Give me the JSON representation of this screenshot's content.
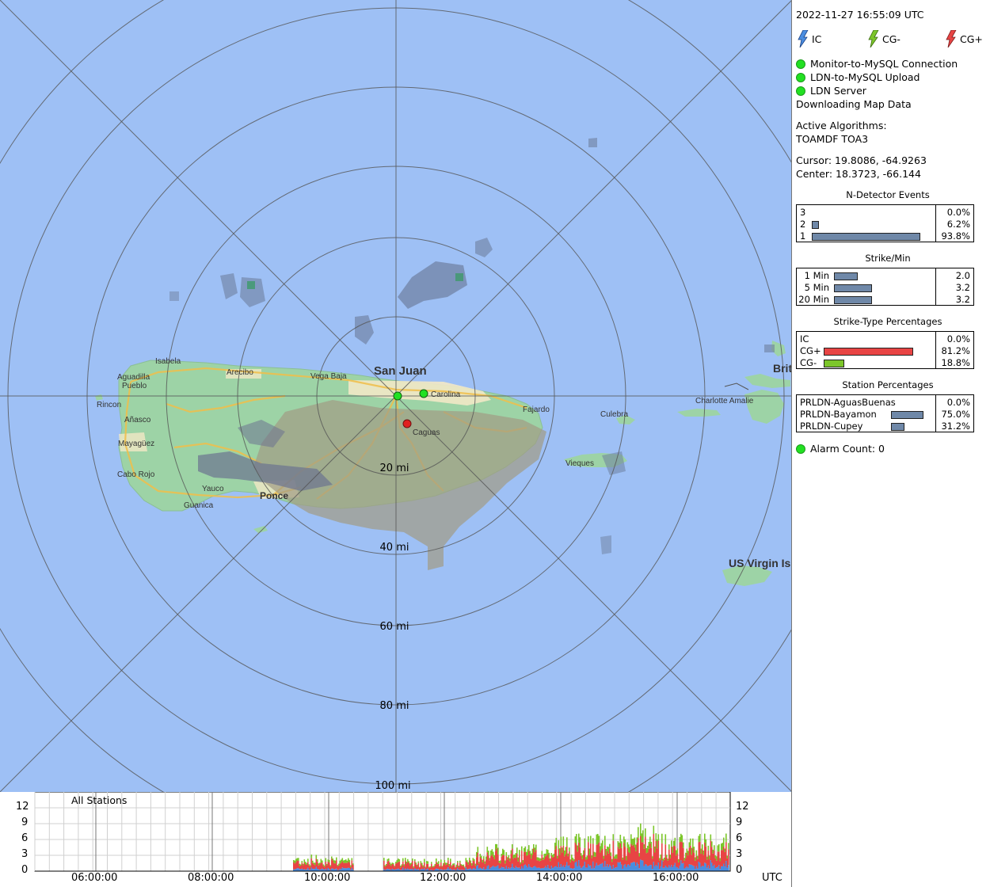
{
  "header": {
    "timestamp": "2022-11-27 16:55:09 UTC"
  },
  "legend": [
    {
      "label": "IC",
      "icon": "bolt-icon",
      "color": "#4a8de0"
    },
    {
      "label": "CG-",
      "icon": "bolt-icon",
      "color": "#7cc62a"
    },
    {
      "label": "CG+",
      "icon": "bolt-icon",
      "color": "#e84444"
    }
  ],
  "status": [
    {
      "label": "Monitor-to-MySQL Connection",
      "color": "#22e022"
    },
    {
      "label": "LDN-to-MySQL Upload",
      "color": "#22e022"
    },
    {
      "label": "LDN Server",
      "color": "#22e022"
    }
  ],
  "status_message": "Downloading Map Data",
  "algorithms": {
    "title": "Active Algorithms:",
    "value": "TOAMDF TOA3"
  },
  "cursor": "Cursor: 19.8086, -64.9263",
  "center": "Center: 18.3723, -66.144",
  "n_detector": {
    "title": "N-Detector Events",
    "rows": [
      {
        "label": "3",
        "percent": 0.0,
        "value": "0.0%"
      },
      {
        "label": "2",
        "percent": 6.2,
        "value": "6.2%"
      },
      {
        "label": "1",
        "percent": 93.8,
        "value": "93.8%"
      }
    ]
  },
  "strike_min": {
    "title": "Strike/Min",
    "rows": [
      {
        "label": "1 Min",
        "amount": 2.0,
        "value": "2.0"
      },
      {
        "label": "5 Min",
        "amount": 3.2,
        "value": "3.2"
      },
      {
        "label": "20 Min",
        "amount": 3.2,
        "value": "3.2"
      }
    ]
  },
  "strike_type": {
    "title": "Strike-Type Percentages",
    "rows": [
      {
        "label": "IC",
        "percent": 0.0,
        "value": "0.0%",
        "color": "#4a8de0"
      },
      {
        "label": "CG+",
        "percent": 81.2,
        "value": "81.2%",
        "color": "#e84444"
      },
      {
        "label": "CG-",
        "percent": 18.8,
        "value": "18.8%",
        "color": "#7cc62a"
      }
    ]
  },
  "station_pct": {
    "title": "Station Percentages",
    "rows": [
      {
        "label": "PRLDN-AguasBuenas",
        "percent": 0.0,
        "value": "0.0%"
      },
      {
        "label": "PRLDN-Bayamon",
        "percent": 75.0,
        "value": "75.0%"
      },
      {
        "label": "PRLDN-Cupey",
        "percent": 31.2,
        "value": "31.2%"
      }
    ]
  },
  "alarm": {
    "label": "Alarm Count: 0",
    "color": "#22e022"
  },
  "map": {
    "range_labels": [
      "20 mi",
      "40 mi",
      "60 mi",
      "80 mi",
      "100 mi"
    ],
    "places": [
      "San Juan",
      "Carolina",
      "Isabela",
      "Aguadilla",
      "Pueblo",
      "Arecibo",
      "Vega Baja",
      "Rincon",
      "Añasco",
      "Mayagüez",
      "Cabo Rojo",
      "Yauco",
      "Guanica",
      "Ponce",
      "Caguas",
      "Fajardo",
      "Culebra",
      "Vieques",
      "Charlotte Amalie",
      "US Virgin Islands",
      "British Virgin Islands"
    ],
    "stations": [
      {
        "name": "Bayamon",
        "color": "#22e022"
      },
      {
        "name": "Carolina",
        "color": "#22e022"
      },
      {
        "name": "Caguas",
        "color": "#e02020"
      }
    ]
  },
  "timeline": {
    "title": "All Stations",
    "y_ticks": [
      "12",
      "9",
      "6",
      "3",
      "0"
    ],
    "x_ticks": [
      "06:00:00",
      "08:00:00",
      "10:00:00",
      "12:00:00",
      "14:00:00",
      "16:00:00"
    ],
    "unit": "UTC",
    "colors": {
      "ic": "#4a8de0",
      "cg_minus": "#7cc62a",
      "cg_plus": "#e84444"
    }
  }
}
